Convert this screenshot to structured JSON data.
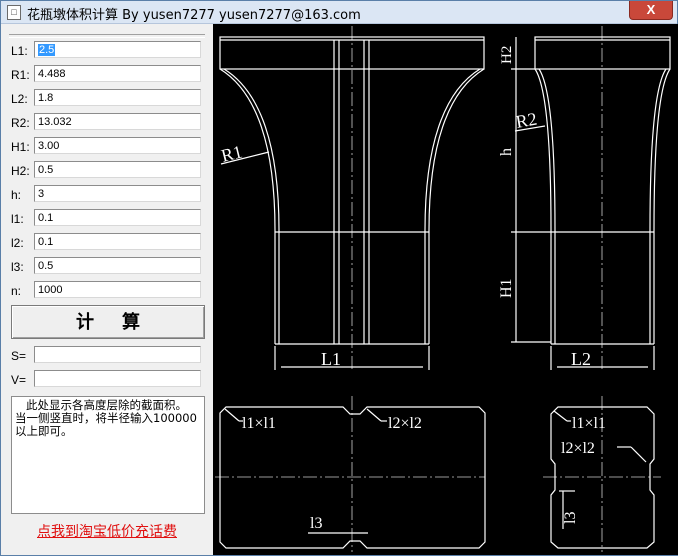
{
  "window": {
    "title": "花瓶墩体积计算 By yusen7277  yusen7277@163.com",
    "close_glyph": "X",
    "icon_glyph": "□"
  },
  "params": [
    {
      "label": "L1:",
      "value": "2.5",
      "selected": true
    },
    {
      "label": "R1:",
      "value": "4.488"
    },
    {
      "label": "L2:",
      "value": "1.8"
    },
    {
      "label": "R2:",
      "value": "13.032"
    },
    {
      "label": "H1:",
      "value": "3.00"
    },
    {
      "label": "H2:",
      "value": "0.5"
    },
    {
      "label": "h:",
      "value": "3"
    },
    {
      "label": "l1:",
      "value": "0.1"
    },
    {
      "label": "l2:",
      "value": "0.1"
    },
    {
      "label": "l3:",
      "value": "0.5"
    },
    {
      "label": "n:",
      "value": "1000"
    }
  ],
  "calc_button": "计算",
  "results": [
    {
      "label": "S=",
      "value": ""
    },
    {
      "label": "V=",
      "value": ""
    }
  ],
  "memo_text": "   此处显示各高度层除的截面积。\n当一侧竖直时，将半径输入100000以上即可。",
  "link_text": "点我到淘宝低价充话费",
  "drawing": {
    "labels": {
      "R1": "R1",
      "R2": "R2",
      "L1": "L1",
      "L2": "L2",
      "H1": "H1",
      "H2": "H2",
      "h": "h",
      "l1xl1": "l1×l1",
      "l2xl2": "l2×l2",
      "l3": "l3"
    },
    "colors": {
      "background": "#000000",
      "line": "#ffffff"
    }
  }
}
